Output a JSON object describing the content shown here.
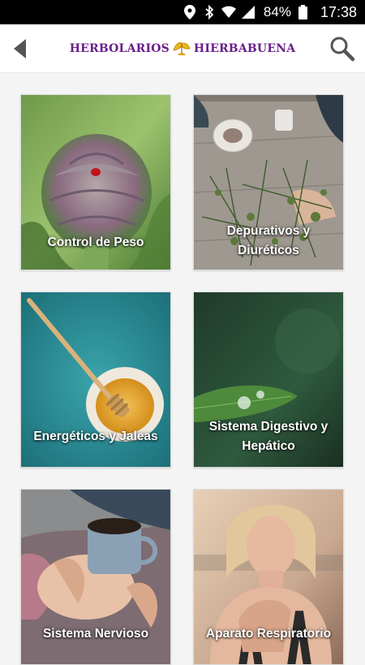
{
  "status_bar": {
    "battery_percent": "84%",
    "time": "17:38",
    "icons": [
      "location-icon",
      "bluetooth-icon",
      "wifi-icon",
      "signal-icon",
      "battery-icon"
    ]
  },
  "app_bar": {
    "brand_left": "HERBOLARIOS",
    "brand_right": "HIERBABUENA",
    "brand_color": "#6b1f8a",
    "icons": [
      "back-arrow-icon",
      "leaf-logo-icon",
      "search-icon"
    ]
  },
  "categories": [
    {
      "label": "Control de Peso"
    },
    {
      "label": "Depurativos y Diuréticos"
    },
    {
      "label": "Energéticos y Jaleas"
    },
    {
      "label": "Sistema Digestivo y Hepático"
    },
    {
      "label": "Sistema Nervioso"
    },
    {
      "label": "Aparato Respiratorio"
    }
  ]
}
